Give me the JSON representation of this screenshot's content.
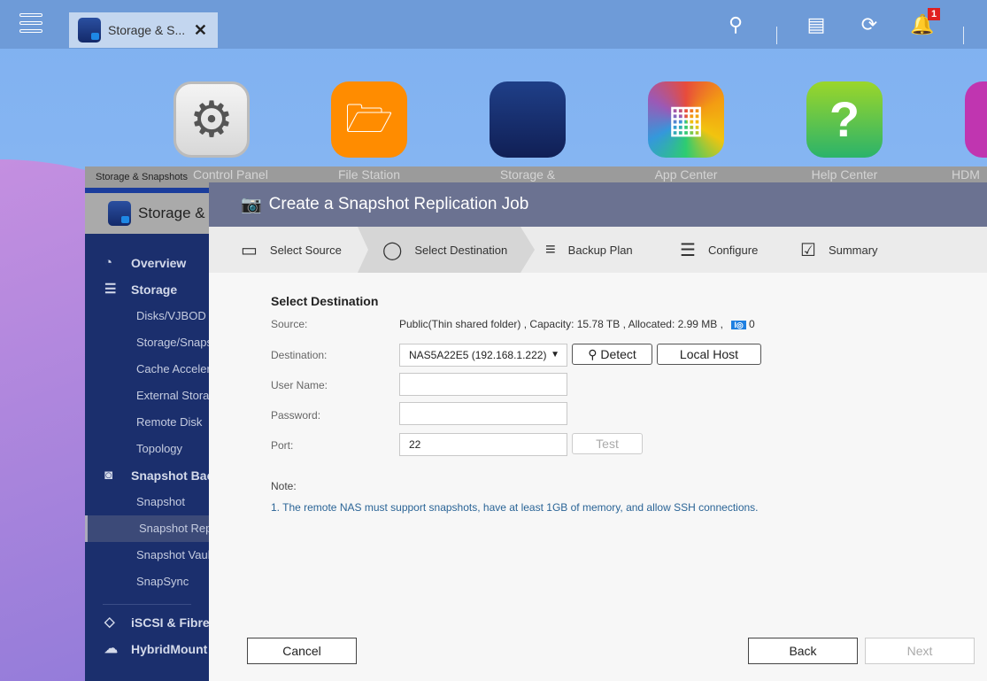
{
  "topbar": {
    "tab_title": "Storage & S...",
    "notification_count": "1"
  },
  "desktop": {
    "icons": [
      {
        "label": "Control Panel"
      },
      {
        "label": "File Station"
      },
      {
        "label": "Storage &"
      },
      {
        "label": "App Center"
      },
      {
        "label": "Help Center"
      },
      {
        "label": "HDM"
      }
    ]
  },
  "back_window": {
    "title": "Storage & Snapshots",
    "header": "Storage & S",
    "nav": [
      {
        "label": "Overview",
        "type": "top",
        "icon": "gauge-icon"
      },
      {
        "label": "Storage",
        "type": "top",
        "icon": "database-icon"
      },
      {
        "label": "Disks/VJBOD",
        "type": "sub"
      },
      {
        "label": "Storage/Snapshots",
        "type": "sub"
      },
      {
        "label": "Cache Acceleration",
        "type": "sub"
      },
      {
        "label": "External Storage",
        "type": "sub"
      },
      {
        "label": "Remote Disk",
        "type": "sub"
      },
      {
        "label": "Topology",
        "type": "sub"
      },
      {
        "label": "Snapshot Backup",
        "type": "top",
        "icon": "camera-icon"
      },
      {
        "label": "Snapshot",
        "type": "sub"
      },
      {
        "label": "Snapshot Replica",
        "type": "sub",
        "active": true
      },
      {
        "label": "Snapshot Vault",
        "type": "sub"
      },
      {
        "label": "SnapSync",
        "type": "sub"
      },
      {
        "label": "iSCSI & Fibre Channel",
        "type": "top",
        "icon": "iscsi-icon"
      },
      {
        "label": "HybridMount",
        "type": "top",
        "icon": "cloud-icon"
      }
    ]
  },
  "dialog": {
    "title": "Create a Snapshot Replication Job",
    "steps": [
      {
        "label": "Select Source",
        "icon": "drive-icon"
      },
      {
        "label": "Select Destination",
        "icon": "cylinder-icon",
        "active": true
      },
      {
        "label": "Backup Plan",
        "icon": "plan-icon"
      },
      {
        "label": "Configure",
        "icon": "list-icon"
      },
      {
        "label": "Summary",
        "icon": "clipboard-icon"
      }
    ],
    "section_title": "Select Destination",
    "source_label": "Source:",
    "source_value": "Public(Thin shared folder) , Capacity: 15.78 TB , Allocated: 2.99 MB ,",
    "snapshot_count": "0",
    "destination_label": "Destination:",
    "destination_value": "NAS5A22E5 (192.168.1.222)",
    "detect_button": "Detect",
    "local_host_button": "Local Host",
    "username_label": "User Name:",
    "username_value": "",
    "password_label": "Password:",
    "password_value": "",
    "port_label": "Port:",
    "port_value": "22",
    "test_button": "Test",
    "note_label": "Note:",
    "note_text": "1. The remote NAS must support snapshots, have at least 1GB of memory, and allow SSH connections.",
    "cancel_button": "Cancel",
    "back_button": "Back",
    "next_button": "Next"
  },
  "colors": {
    "dialog_header": "#6b7291",
    "sidebar": "#1b2f6d",
    "note_text": "#2a6496"
  }
}
